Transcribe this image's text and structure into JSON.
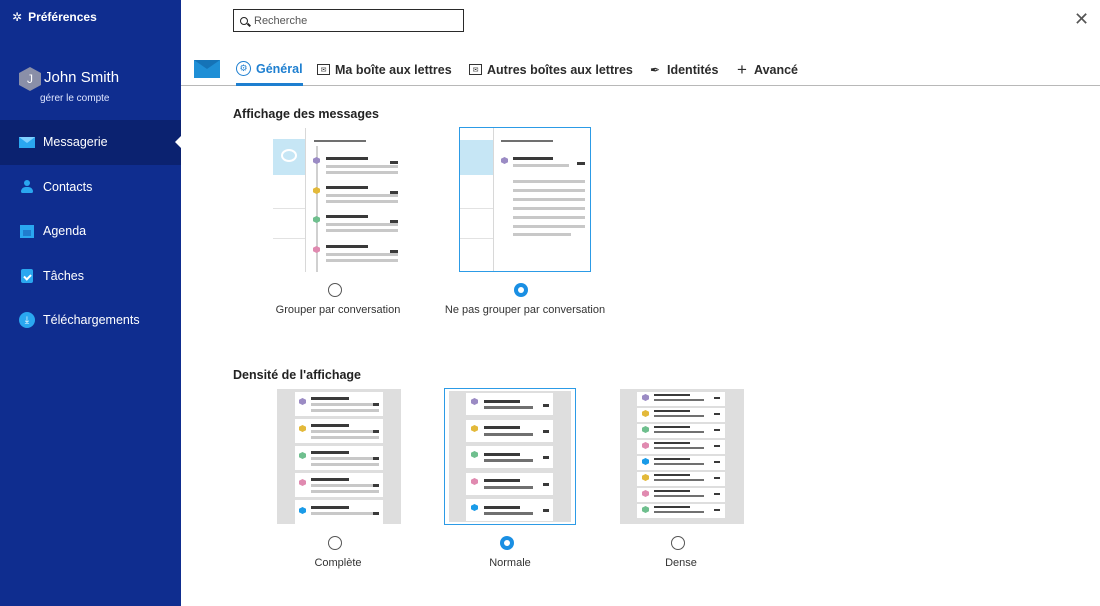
{
  "sidebar": {
    "title": "Préférences",
    "user_initial": "J",
    "user_name": "John Smith",
    "manage_label": "gérer le compte",
    "items": [
      {
        "label": "Messagerie",
        "icon": "mail-icon",
        "active": true
      },
      {
        "label": "Contacts",
        "icon": "contact-icon",
        "active": false
      },
      {
        "label": "Agenda",
        "icon": "calendar-icon",
        "active": false
      },
      {
        "label": "Tâches",
        "icon": "tasks-icon",
        "active": false
      },
      {
        "label": "Téléchargements",
        "icon": "download-icon",
        "active": false
      }
    ]
  },
  "search": {
    "placeholder": "Recherche",
    "value": ""
  },
  "tabs": [
    {
      "label": "Général",
      "icon": "general-settings-icon",
      "active": true
    },
    {
      "label": "Ma boîte aux lettres",
      "icon": "mailbox-icon",
      "active": false
    },
    {
      "label": "Autres boîtes aux lettres",
      "icon": "other-mailboxes-icon",
      "active": false
    },
    {
      "label": "Identités",
      "icon": "signature-pen-icon",
      "active": false
    },
    {
      "label": "Avancé",
      "icon": "plus-icon",
      "active": false
    }
  ],
  "display": {
    "title": "Affichage des messages",
    "options": [
      {
        "label": "Grouper par conversation",
        "selected": false
      },
      {
        "label": "Ne pas grouper par conversation",
        "selected": true
      }
    ]
  },
  "density": {
    "title": "Densité de l'affichage",
    "options": [
      {
        "label": "Complète",
        "selected": false
      },
      {
        "label": "Normale",
        "selected": true
      },
      {
        "label": "Dense",
        "selected": false
      }
    ]
  },
  "colors": {
    "sidebar_bg": "#0f2d8f",
    "sidebar_active": "#0b2270",
    "accent": "#1e7fd0",
    "dot_purple": "#9b8bc4",
    "dot_yellow": "#e3b93a",
    "dot_green": "#6fbf8e",
    "dot_pink": "#e08ab0",
    "dot_blue": "#1a9be8"
  }
}
